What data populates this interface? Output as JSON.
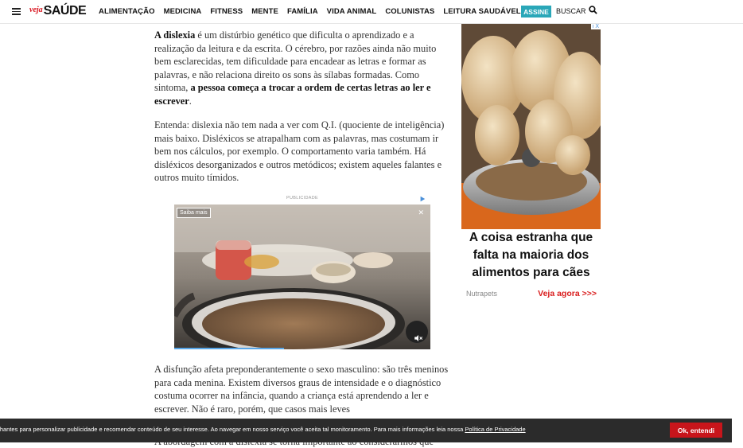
{
  "header": {
    "logo_veja": "veja",
    "logo_saude": "SAÚDE",
    "nav": [
      "ALIMENTAÇÃO",
      "MEDICINA",
      "FITNESS",
      "MENTE",
      "FAMÍLIA",
      "VIDA ANIMAL",
      "COLUNISTAS",
      "LEITURA SAUDÁVEL"
    ],
    "subscribe_label": "ASSINE",
    "search_label": "BUSCAR",
    "menu_icon": "hamburger-icon",
    "search_icon": "search-icon",
    "brand_color": "#d9141e",
    "accent_color": "#2aa7b8"
  },
  "article": {
    "p1_lead_bold": "A dislexia",
    "p1_text": " é um distúrbio genético que dificulta o aprendizado e a realização da leitura e da escrita. O cérebro, por razões ainda não muito bem esclarecidas, tem dificuldade para encadear as letras e formar as palavras, e não relaciona direito os sons às sílabas formadas. Como sintoma, ",
    "p1_bold_end": "a pessoa começa a trocar a ordem de certas letras ao ler e escrever",
    "p1_period": ".",
    "p2": "Entenda: dislexia não tem nada a ver com Q.I. (quociente de inteligência) mais baixo. Disléxicos se atrapalham com as palavras, mas costumam ir bem nos cálculos, por exemplo. O comportamento varia também. Há disléxicos desorganizados e outros metódicos; existem aqueles falantes e outros muito tímidos.",
    "p3": "A disfunção afeta preponderantemente o sexo masculino: são três meninos para cada menina. Existem diversos graus de intensidade e o diagnóstico costuma ocorrer na infância, quando a criança está aprendendo a ler e escrever. Não é raro, porém, que casos mais leves",
    "p4_partial": "A abordagem com a dislexia se torna importante ao considerarmos que"
  },
  "inline_ad": {
    "label": "PUBLICIDADE",
    "cta": "Saiba mais",
    "progress": 0.43,
    "icons": [
      "adchoices-icon",
      "close-icon",
      "mute-icon"
    ]
  },
  "sidebar_ad": {
    "headline": "A coisa estranha que falta na maioria dos alimentos para cães",
    "source": "Nutrapets",
    "cta": "Veja agora >>>",
    "ad_marker": "i X",
    "cta_color": "#d91c1c"
  },
  "cookie_bar": {
    "text": "elhantes para personalizar publicidade e recomendar conteúdo de seu interesse. Ao navegar em nosso serviço você aceita tal monitoramento. Para mais informações leia nossa ",
    "link": "Política de Privacidade",
    "button": "Ok, entendi",
    "button_color": "#c8151b"
  }
}
